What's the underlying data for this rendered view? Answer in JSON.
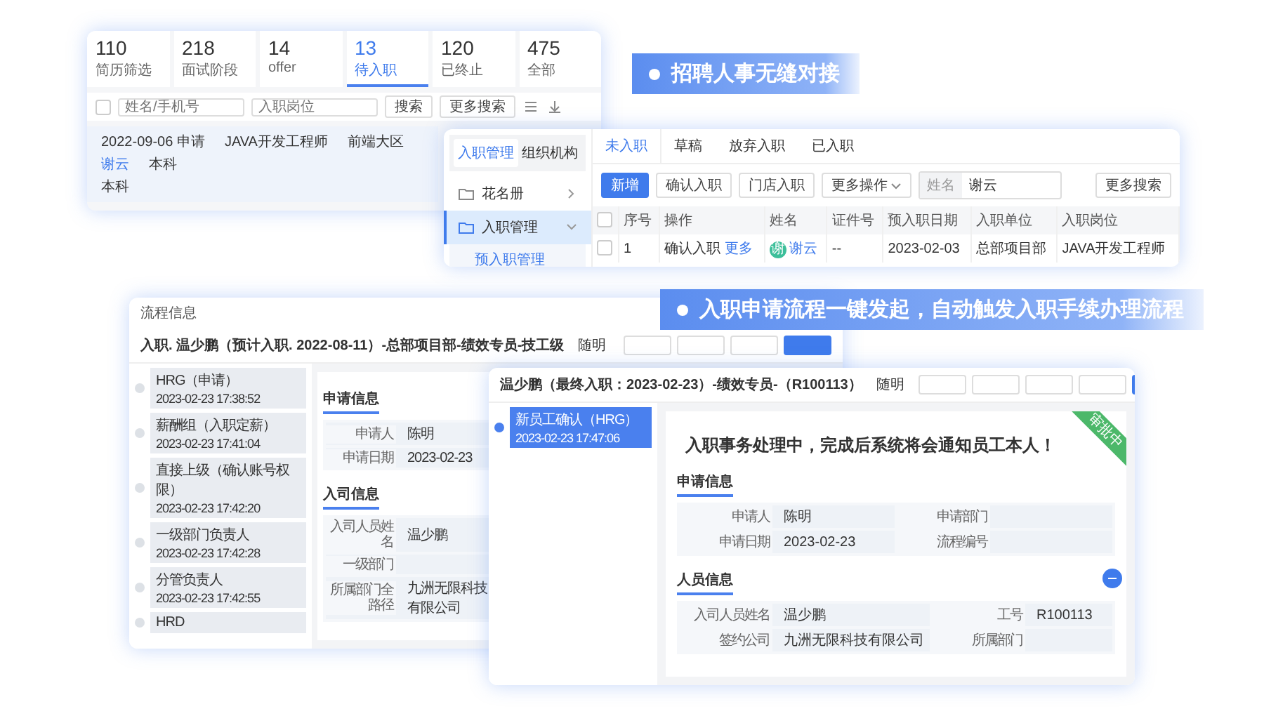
{
  "stats_window": {
    "stats": [
      {
        "value": "110",
        "label": "简历筛选",
        "selected": false
      },
      {
        "value": "218",
        "label": "面试阶段",
        "selected": false
      },
      {
        "value": "14",
        "label": "offer",
        "selected": false
      },
      {
        "value": "13",
        "label": "待入职",
        "selected": true
      },
      {
        "value": "120",
        "label": "已终止",
        "selected": false
      },
      {
        "value": "475",
        "label": "全部",
        "selected": false
      }
    ],
    "select_all": {
      "checked": false
    },
    "search_fields": [
      {
        "placeholder": "姓名/手机号"
      },
      {
        "placeholder": "入职岗位"
      }
    ],
    "buttons": [
      "搜索",
      "更多搜索"
    ],
    "row": {
      "date": "2022-09-06 申请",
      "position": "JAVA开发工程师",
      "region": "前端大区",
      "name": "谢云",
      "education": "本科",
      "degree": "本科"
    }
  },
  "banners": [
    "招聘人事无缝对接",
    "入职申请流程一键发起，自动触发入职手续办理流程"
  ],
  "onboarding_window": {
    "side_tabs": [
      {
        "label": "入职管理",
        "selected": true
      },
      {
        "label": "组织机构",
        "selected": false
      }
    ],
    "menu": [
      {
        "label": "花名册",
        "expanded": false,
        "selected": false
      },
      {
        "label": "入职管理",
        "expanded": true,
        "selected": true,
        "children": [
          {
            "label": "预入职管理"
          }
        ]
      }
    ],
    "tabs": [
      {
        "label": "未入职",
        "selected": true
      },
      {
        "label": "草稿",
        "selected": false
      },
      {
        "label": "放弃入职",
        "selected": false
      },
      {
        "label": "已入职",
        "selected": false
      }
    ],
    "actions": [
      {
        "label": "新增",
        "kind": "primary"
      },
      {
        "label": "确认入职",
        "kind": "plain"
      },
      {
        "label": "门店入职",
        "kind": "plain"
      },
      {
        "label": "更多操作",
        "kind": "dropdown"
      }
    ],
    "search": {
      "label": "姓名",
      "value": "谢云"
    },
    "more_search": "更多搜索",
    "table": {
      "select_all_checked": false,
      "columns": [
        "序号",
        "操作",
        "姓名",
        "证件号",
        "预入职日期",
        "入职单位",
        "入职岗位"
      ],
      "rows": [
        {
          "checked": false,
          "index": "1",
          "actions": [
            "确认入职",
            "更多"
          ],
          "avatar": "谢",
          "name": "谢云",
          "id_number": "--",
          "date": "2023-02-03",
          "unit": "总部项目部",
          "position": "JAVA开发工程师"
        }
      ]
    }
  },
  "process_window": {
    "title": "流程信息",
    "heading": "入职. 温少鹏（预计入职. 2022-08-11）-总部项目部-绩效专员-技工级",
    "tag": "随明",
    "steps": [
      {
        "name": "HRG（申请）",
        "time": "2023-02-23 17:38:52"
      },
      {
        "name": "薪酬组（入职定薪）",
        "time": "2023-02-23 17:41:04"
      },
      {
        "name": "直接上级（确认账号权限）",
        "time": "2023-02-23 17:42:20"
      },
      {
        "name": "一级部门负责人",
        "time": "2023-02-23 17:42:28"
      },
      {
        "name": "分管负责人",
        "time": "2023-02-23 17:42:55"
      },
      {
        "name": "HRD"
      }
    ],
    "sections": [
      {
        "title": "申请信息",
        "fields": [
          {
            "label": "申请人",
            "value": "陈明"
          },
          {
            "label": "申请日期",
            "value": "2023-02-23"
          }
        ]
      },
      {
        "title": "入司信息",
        "fields": [
          {
            "label": "入司人员姓名",
            "value": "温少鹏"
          },
          {
            "label": "一级部门"
          },
          {
            "label": "所属部门全路径",
            "value": "九洲无限科技有限公司"
          }
        ]
      }
    ]
  },
  "detail_window": {
    "heading": "温少鹏（最终入职：2023-02-23）-绩效专员-（R100113）",
    "tag": "随明",
    "step": {
      "name": "新员工确认（HRG）",
      "time": "2023-02-23 17:47:06"
    },
    "notice": "入职事务处理中，完成后系统将会通知员工本人！",
    "ribbon": "审批中",
    "sections": [
      {
        "title": "申请信息",
        "fields": [
          {
            "label": "申请人",
            "value": "陈明"
          },
          {
            "label": "申请部门"
          },
          {
            "label": "申请日期",
            "value": "2023-02-23"
          },
          {
            "label": "流程编号"
          }
        ]
      },
      {
        "title": "人员信息",
        "fields": [
          {
            "label": "入司人员姓名",
            "value": "温少鹏"
          },
          {
            "label": "工号",
            "value": "R100113"
          },
          {
            "label": "签约公司",
            "value": "九洲无限科技有限公司"
          },
          {
            "label": "所属部门"
          }
        ]
      }
    ]
  }
}
